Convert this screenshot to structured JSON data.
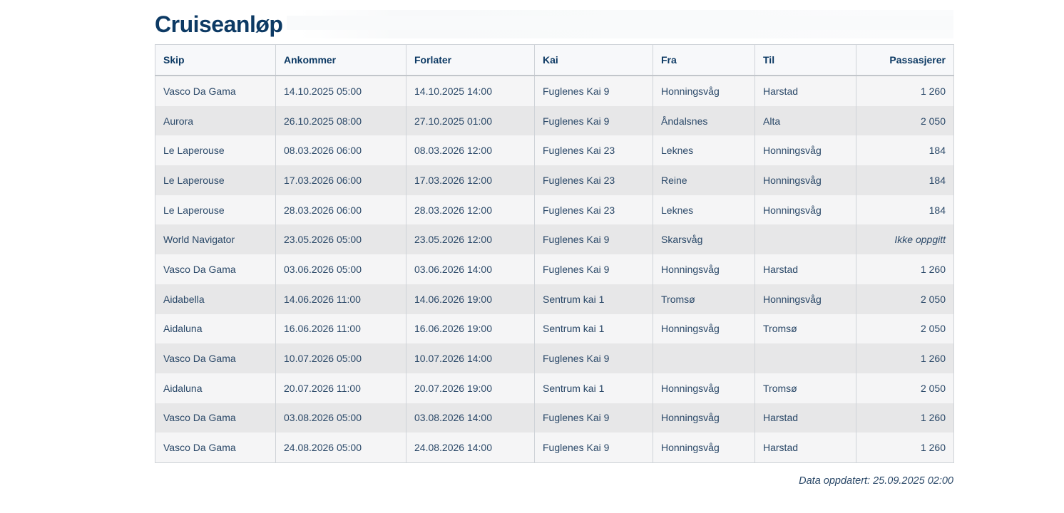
{
  "page": {
    "title": "Cruiseanløp",
    "updated": "Data oppdatert: 25.09.2025 02:00"
  },
  "table": {
    "headers": [
      "Skip",
      "Ankommer",
      "Forlater",
      "Kai",
      "Fra",
      "Til",
      "Passasjerer"
    ],
    "rows": [
      [
        "Vasco Da Gama",
        "14.10.2025 05:00",
        "14.10.2025 14:00",
        "Fuglenes Kai 9",
        "Honningsvåg",
        "Harstad",
        "1 260"
      ],
      [
        "Aurora",
        "26.10.2025 08:00",
        "27.10.2025 01:00",
        "Fuglenes Kai 9",
        "Åndalsnes",
        "Alta",
        "2 050"
      ],
      [
        "Le Laperouse",
        "08.03.2026 06:00",
        "08.03.2026 12:00",
        "Fuglenes Kai 23",
        "Leknes",
        "Honningsvåg",
        "184"
      ],
      [
        "Le Laperouse",
        "17.03.2026 06:00",
        "17.03.2026 12:00",
        "Fuglenes Kai 23",
        "Reine",
        "Honningsvåg",
        "184"
      ],
      [
        "Le Laperouse",
        "28.03.2026 06:00",
        "28.03.2026 12:00",
        "Fuglenes Kai 23",
        "Leknes",
        "Honningsvåg",
        "184"
      ],
      [
        "World Navigator",
        "23.05.2026 05:00",
        "23.05.2026 12:00",
        "Fuglenes Kai 9",
        "Skarsvåg",
        "",
        "Ikke oppgitt"
      ],
      [
        "Vasco Da Gama",
        "03.06.2026 05:00",
        "03.06.2026 14:00",
        "Fuglenes Kai 9",
        "Honningsvåg",
        "Harstad",
        "1 260"
      ],
      [
        "Aidabella",
        "14.06.2026 11:00",
        "14.06.2026 19:00",
        "Sentrum kai 1",
        "Tromsø",
        "Honningsvåg",
        "2 050"
      ],
      [
        "Aidaluna",
        "16.06.2026 11:00",
        "16.06.2026 19:00",
        "Sentrum kai 1",
        "Honningsvåg",
        "Tromsø",
        "2 050"
      ],
      [
        "Vasco Da Gama",
        "10.07.2026 05:00",
        "10.07.2026 14:00",
        "Fuglenes Kai 9",
        "",
        "",
        "1 260"
      ],
      [
        "Aidaluna",
        "20.07.2026 11:00",
        "20.07.2026 19:00",
        "Sentrum kai 1",
        "Honningsvåg",
        "Tromsø",
        "2 050"
      ],
      [
        "Vasco Da Gama",
        "03.08.2026 05:00",
        "03.08.2026 14:00",
        "Fuglenes Kai 9",
        "Honningsvåg",
        "Harstad",
        "1 260"
      ],
      [
        "Vasco Da Gama",
        "24.08.2026 05:00",
        "24.08.2026 14:00",
        "Fuglenes Kai 9",
        "Honningsvåg",
        "Harstad",
        "1 260"
      ]
    ]
  }
}
